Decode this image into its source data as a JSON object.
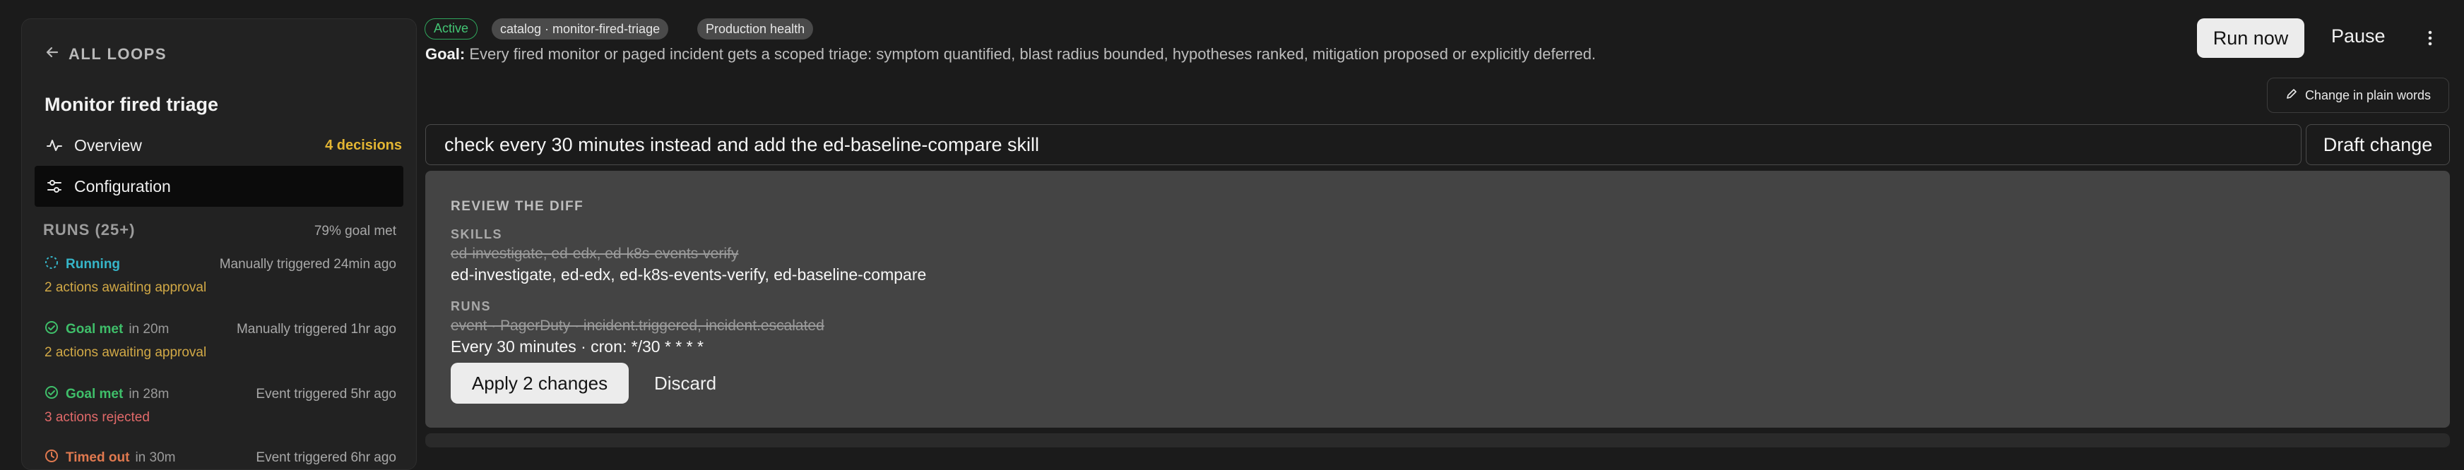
{
  "sidebar": {
    "back_label": "ALL LOOPS",
    "loop_title": "Monitor fired triage",
    "nav": {
      "overview_label": "Overview",
      "overview_badge": "4 decisions",
      "configuration_label": "Configuration"
    },
    "runs_header": "RUNS (25+)",
    "runs_goal_pct": "79% goal met",
    "runs": [
      {
        "status": "Running",
        "duration": "",
        "trigger": "Manually triggered 24min ago",
        "note": "2 actions awaiting approval",
        "status_icon": "spinner-icon"
      },
      {
        "status": "Goal met",
        "duration": "in 20m",
        "trigger": "Manually triggered 1hr ago",
        "note": "2 actions awaiting approval",
        "status_icon": "check-circle-icon"
      },
      {
        "status": "Goal met",
        "duration": "in 28m",
        "trigger": "Event triggered 5hr ago",
        "note": "3 actions rejected",
        "status_icon": "check-circle-icon"
      },
      {
        "status": "Timed out",
        "duration": "in 30m",
        "trigger": "Event triggered 6hr ago",
        "note": "",
        "status_icon": "clock-icon"
      }
    ]
  },
  "header": {
    "chips": [
      "Active",
      "catalog · monitor-fired-triage",
      "Production health"
    ],
    "goal_label": "Goal:",
    "goal_text": "Every fired monitor or paged incident gets a scoped triage: symptom quantified, blast radius bounded, hypotheses ranked, mitigation proposed or explicitly deferred.",
    "run_now_label": "Run now",
    "pause_label": "Pause",
    "change_plain_label": "Change in plain words"
  },
  "command": {
    "value": "check every 30 minutes instead and add the ed-baseline-compare skill",
    "draft_label": "Draft change"
  },
  "diff": {
    "title": "REVIEW THE DIFF",
    "skills_label": "SKILLS",
    "skills_old": "ed-investigate, ed-edx, ed-k8s-events-verify",
    "skills_new": "ed-investigate, ed-edx, ed-k8s-events-verify, ed-baseline-compare",
    "runs_label": "RUNS",
    "runs_old": "event · PagerDuty · incident.triggered, incident.escalated",
    "runs_new": "Every 30 minutes · cron: */30 * * * *",
    "apply_label": "Apply 2 changes",
    "discard_label": "Discard"
  },
  "colors": {
    "accent_green": "#3fbf6a",
    "running_teal": "#36b6c9",
    "warning_amber": "#d2a946",
    "error_red": "#e26a6a",
    "badge_yellow": "#e3b533"
  }
}
